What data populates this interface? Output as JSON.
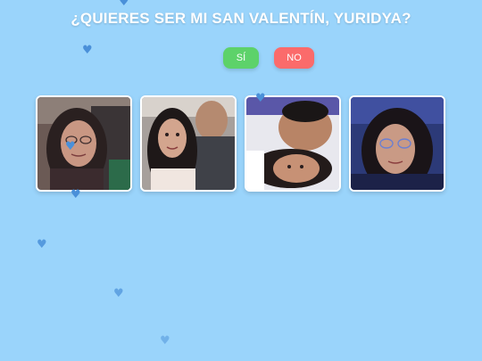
{
  "title": "¿QUIERES SER MI SAN VALENTÍN, YURIDYA?",
  "buttons": {
    "yes_label": "SÍ",
    "no_label": "NO"
  },
  "colors": {
    "background": "#9ad4fb",
    "yes_button": "#5dd26a",
    "no_button": "#fb6b6b",
    "heart": "#4a90d9"
  },
  "photos": [
    {
      "icon": "couple-selfie-photo-1"
    },
    {
      "icon": "couple-selfie-photo-2"
    },
    {
      "icon": "couple-selfie-photo-3"
    },
    {
      "icon": "couple-selfie-photo-4"
    }
  ],
  "hearts": {
    "glyph": "♥",
    "icon": "heart-icon"
  }
}
